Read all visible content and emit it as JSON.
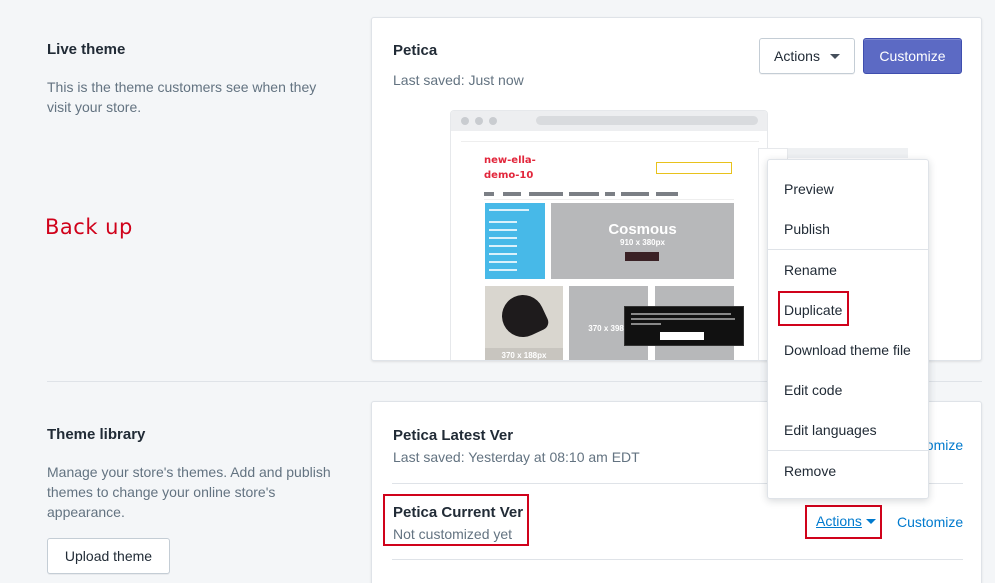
{
  "live_theme": {
    "heading": "Live theme",
    "description": "This is the theme customers see when they visit your store.",
    "theme_name": "Petica",
    "last_saved": "Last saved: Just now",
    "actions_label": "Actions",
    "customize_label": "Customize"
  },
  "annotation": {
    "back_up": "Back up"
  },
  "preview": {
    "store_line1": "new-ella-",
    "store_line2": "demo-10",
    "hero_title": "Cosmous",
    "hero_size": "910 x 380px",
    "tile_size_1": "370 x 188px",
    "tile_size_2": "370 x 398p"
  },
  "theme_library": {
    "heading": "Theme library",
    "description": "Manage your store's themes. Add and publish themes to change your online store's appearance.",
    "upload_label": "Upload theme",
    "themes": [
      {
        "name": "Petica Latest Ver",
        "status": "Last saved: Yesterday at 08:10 am EDT",
        "customize_label": "Customize"
      },
      {
        "name": "Petica Current Ver",
        "status": "Not customized yet",
        "actions_label": "Actions",
        "customize_label": "Customize"
      }
    ]
  },
  "actions_menu": {
    "items": [
      "Preview",
      "Publish",
      "Rename",
      "Duplicate",
      "Download theme file",
      "Edit code",
      "Edit languages",
      "Remove"
    ]
  },
  "colors": {
    "primary": "#5c6ac4",
    "link": "#007ace",
    "annotation": "#d0021b"
  }
}
